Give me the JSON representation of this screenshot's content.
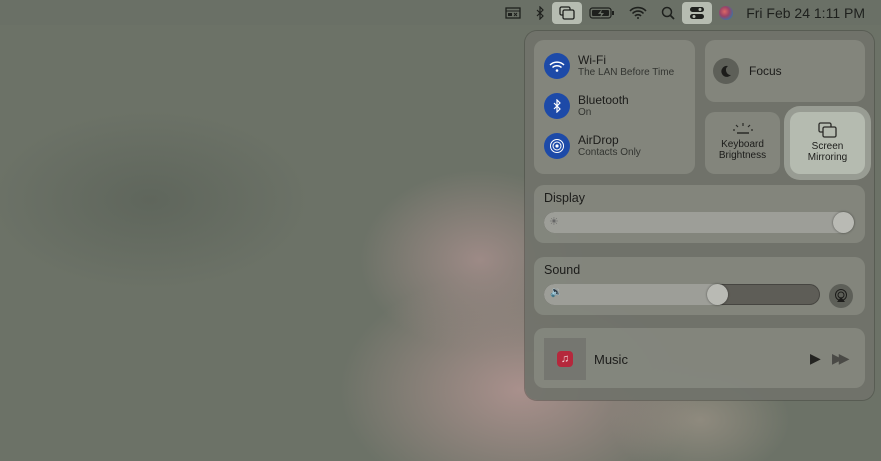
{
  "menubar": {
    "clock": "Fri Feb 24  1:11 PM",
    "icons": [
      "menu-extra-icon",
      "bluetooth-icon",
      "screen-mirroring-icon",
      "battery-charging-icon",
      "wifi-icon",
      "spotlight-search-icon",
      "control-center-icon",
      "siri-icon"
    ]
  },
  "control_center": {
    "wifi": {
      "label": "Wi-Fi",
      "status": "The LAN Before Time"
    },
    "bluetooth": {
      "label": "Bluetooth",
      "status": "On"
    },
    "airdrop": {
      "label": "AirDrop",
      "status": "Contacts Only"
    },
    "focus": {
      "label": "Focus"
    },
    "keyboard_brightness": {
      "label1": "Keyboard",
      "label2": "Brightness"
    },
    "screen_mirroring": {
      "label1": "Screen",
      "label2": "Mirroring"
    },
    "display": {
      "label": "Display",
      "brightness_percent": 100
    },
    "sound": {
      "label": "Sound",
      "volume_percent": 64
    },
    "now_playing": {
      "app": "Music"
    }
  }
}
